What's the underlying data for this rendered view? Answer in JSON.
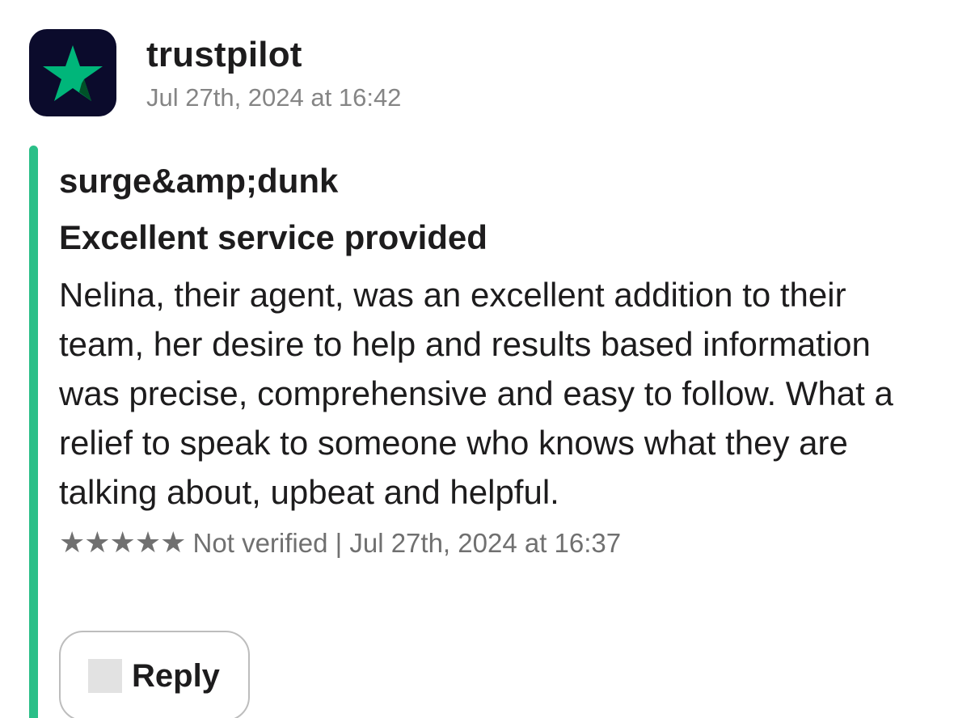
{
  "message": {
    "sender": "trustpilot",
    "timestamp": "Jul 27th, 2024 at 16:42",
    "avatar_icon": "trustpilot-star-icon",
    "colors": {
      "avatar_bg": "#0b0b2c",
      "star": "#00b67a",
      "accent_bar": "#2bbf88"
    }
  },
  "review": {
    "author": "surge&amp;dunk",
    "title": "Excellent service provided",
    "body": "Nelina, their agent, was an excellent addition to their team, her desire to help and results based information was precise, comprehensive and easy to follow. What a relief to speak to someone who knows what they are talking about, upbeat and helpful.",
    "stars": "★★★★★",
    "rating": 5,
    "meta_text": " Not verified | Jul 27th, 2024 at 16:37"
  },
  "actions": {
    "reply_label": "Reply",
    "reply_icon": "reply-icon"
  }
}
